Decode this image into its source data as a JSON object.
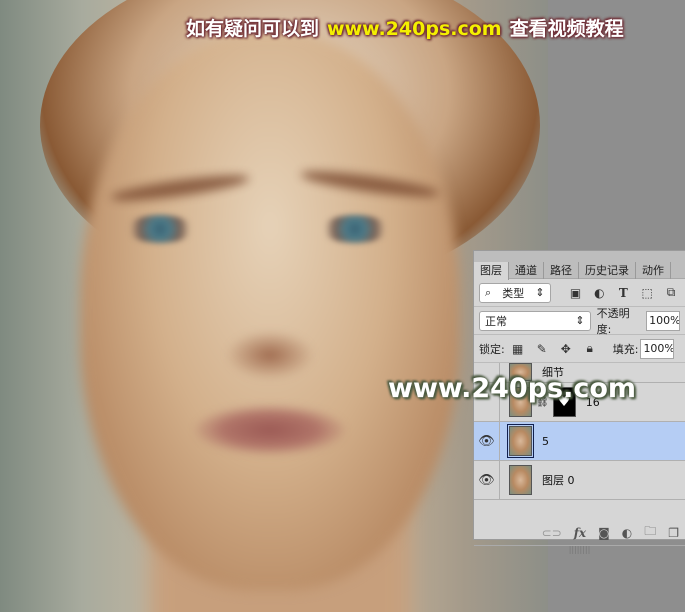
{
  "banner": {
    "left": "如有疑问可以到",
    "url": "www.240ps.com",
    "right": "查看视频教程"
  },
  "watermark": "www.240ps.com",
  "panel": {
    "tabs": [
      "图层",
      "通道",
      "路径",
      "历史记录",
      "动作"
    ],
    "filter_label": "类型",
    "blend_mode": "正常",
    "opacity_label": "不透明度:",
    "opacity_value": "100%",
    "lock_label": "锁定:",
    "fill_label": "填充:",
    "fill_value": "100%",
    "layers": [
      {
        "name": "细节",
        "visible": false
      },
      {
        "name": "16",
        "visible": false,
        "has_mask": true
      },
      {
        "name": "5",
        "visible": true,
        "selected": true
      },
      {
        "name": "图层 0",
        "visible": true
      }
    ]
  },
  "colors": {
    "selected_layer": "#b5cdf4",
    "banner_url": "#f4f000"
  }
}
